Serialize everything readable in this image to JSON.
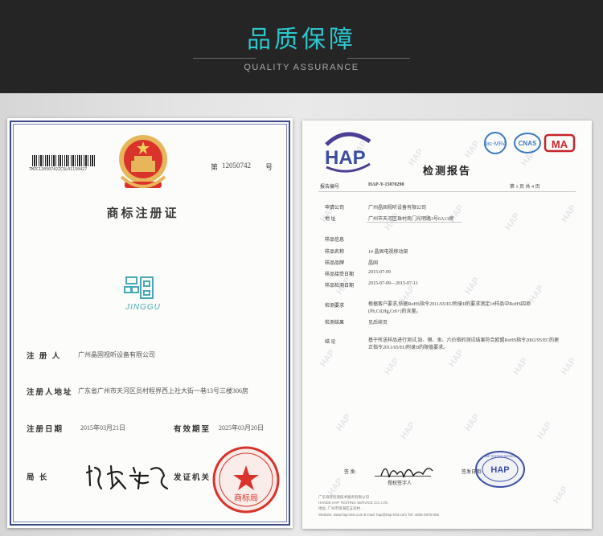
{
  "header": {
    "title": "品质保障",
    "subtitle": "QUALITY ASSURANCE"
  },
  "trademark_certificate": {
    "barcode_text": "TMZC12050742ZCSL01150427",
    "number_prefix": "第",
    "number": "12050742",
    "number_suffix": "号",
    "title": "商标注册证",
    "logo_text": "JINGGU",
    "fields": [
      {
        "label": "注 册 人",
        "value": "广州晶固视听设备有限公司"
      },
      {
        "label": "注册人地址",
        "value": "广东省广州市天河区员村程界西上社大街一巷13号三楼306房"
      },
      {
        "label": "注册日期",
        "value": "2015年03月21日"
      },
      {
        "label": "有效期至",
        "value": "2025年03月20日"
      },
      {
        "label": "局    长",
        "value": ""
      },
      {
        "label": "发证机关",
        "value": ""
      }
    ],
    "seal_text": "商标局",
    "seal_ring_text": "中华人民共和国国家工商行政管理总局"
  },
  "test_report": {
    "brand": "HAP",
    "title": "检测报告",
    "accreditation": [
      "ilac-MRA",
      "CNAS",
      "MA"
    ],
    "report_no_label": "报告编号",
    "report_no": "HAP-Y-15070298",
    "page_label": "第 1 页  共 4 页",
    "rows": [
      {
        "label": "申请公司",
        "value": "广州晶固视听设备有限公司"
      },
      {
        "label": "地    址",
        "value": "广州市天河区珠村南门光明路3号6A13房"
      },
      {
        "label": "样品信息",
        "value": ""
      },
      {
        "label": "样品名称",
        "value": "1# 晶固电视移动架"
      },
      {
        "label": "样品品牌",
        "value": "晶固"
      },
      {
        "label": "样品接受日期",
        "value": "2015-07-09"
      },
      {
        "label": "样品检测日期",
        "value": "2015-07-09—2015-07-11"
      },
      {
        "label": "检测要求",
        "value": "根据客户要求,依据RoHS指令2011/65/EU附录II的要求测定1#样品中RoHS四项(Pb,Cd,Hg,Cr6+)的含量。"
      },
      {
        "label": "检测结果",
        "value": "见后续页"
      },
      {
        "label": "结    论",
        "value": "基于所送样品进行测试,铅、镉、汞、六价铬的测试结果符合欧盟RoHS指令2002/95/EC的更正指令2011/65/EU附录II的限值要求。"
      }
    ],
    "sign_label_left": "签    发:",
    "sign_label_left_sub": "授权签字人",
    "sign_label_right": "签发日期:",
    "seal_text": "HAP TESTING SERVICE",
    "footer": [
      "广东海普检测技术服务有限公司",
      "HANDE HAP TESTING SERVICE CO.,LTD",
      "地址: 广州市珠海区五凤村 ...",
      "Website: www.hap-test.com      E-mail: hap@hap-test.com      Tel: 4006-4976-006"
    ]
  },
  "colors": {
    "header_bg": "#252525",
    "accent": "#2bc7cf",
    "seal_red": "#d9332b",
    "seal_blue": "#3a4fa5"
  }
}
